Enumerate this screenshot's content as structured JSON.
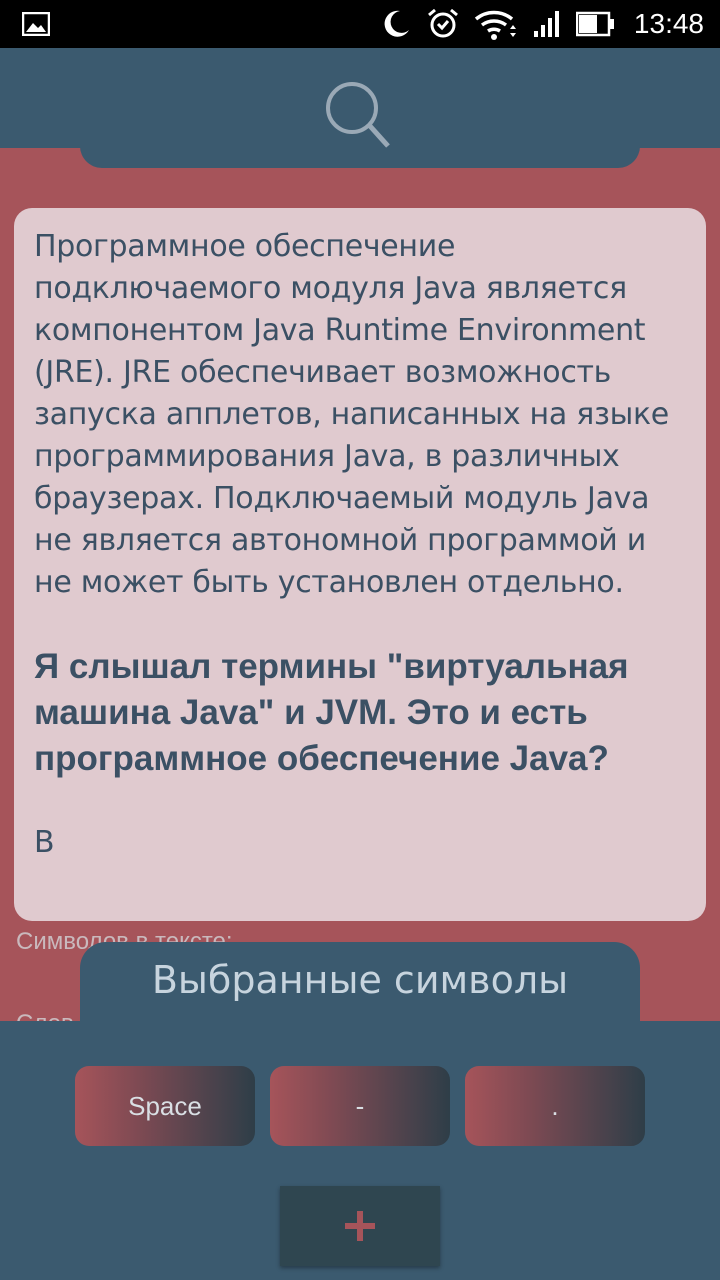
{
  "status_bar": {
    "time": "13:48",
    "icons": [
      "gallery-icon",
      "moon-icon",
      "alarm-icon",
      "wifi-icon",
      "signal-icon",
      "battery-icon"
    ]
  },
  "header": {
    "search_icon": "search-icon"
  },
  "content": {
    "paragraph": "Программное обеспечение подключаемого модуля Java является компонентом Java Runtime Environment (JRE). JRE обеспечивает возможность запуска апплетов, написанных на языке программирования Java, в различных браузерах. Подключаемый модуль Java не является автономной программой и не может быть установлен отдельно.",
    "question": "Я слышал термины \"виртуальная машина Java\" и JVM. Это и есть программное обеспечение Java?",
    "answer_start": "В"
  },
  "stats": {
    "chars_label": "Символов в тексте:",
    "words_label": "Слов"
  },
  "panel": {
    "title": "Выбранные символы",
    "chips": [
      "Space",
      "-",
      "."
    ],
    "add_label": "+"
  },
  "colors": {
    "background": "#a6545a",
    "panel": "#3b5a6f",
    "card": "#e0cacf",
    "text": "#3b5064",
    "accent": "#a6545a"
  }
}
